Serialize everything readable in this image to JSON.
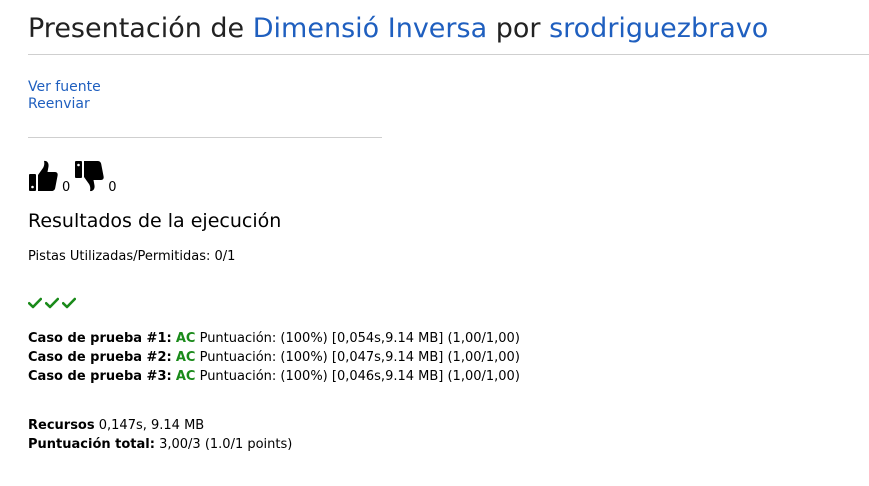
{
  "header": {
    "prefix": "Presentación de",
    "problem_link": "Dimensió Inversa",
    "middle": "por",
    "user_link": "srodriguezbravo"
  },
  "actions": {
    "view_source": "Ver fuente",
    "resubmit": "Reenviar"
  },
  "votes": {
    "up_count": "0",
    "down_count": "0",
    "up_icon": "thumbs-up-icon",
    "down_icon": "thumbs-down-icon"
  },
  "results": {
    "title": "Resultados de la ejecución",
    "hints": "Pistas Utilizadas/Permitidas: 0/1",
    "check_icons": [
      "check-icon",
      "check-icon",
      "check-icon"
    ],
    "test_cases": [
      {
        "label": "Caso de prueba #1:",
        "status": "AC",
        "detail": "Puntuación: (100%) [0,054s,9.14 MB] (1,00/1,00)"
      },
      {
        "label": "Caso de prueba #2:",
        "status": "AC",
        "detail": "Puntuación: (100%) [0,047s,9.14 MB] (1,00/1,00)"
      },
      {
        "label": "Caso de prueba #3:",
        "status": "AC",
        "detail": "Puntuación: (100%) [0,046s,9.14 MB] (1,00/1,00)"
      }
    ],
    "resources_label": "Recursos",
    "resources_value": "0,147s, 9.14 MB",
    "total_label": "Puntuación total:",
    "total_value": "3,00/3 (1.0/1 points)"
  },
  "colors": {
    "link": "#1f5fbf",
    "accepted": "#1a8a1a",
    "title_text": "#222222",
    "rule": "#cfcfcf"
  }
}
